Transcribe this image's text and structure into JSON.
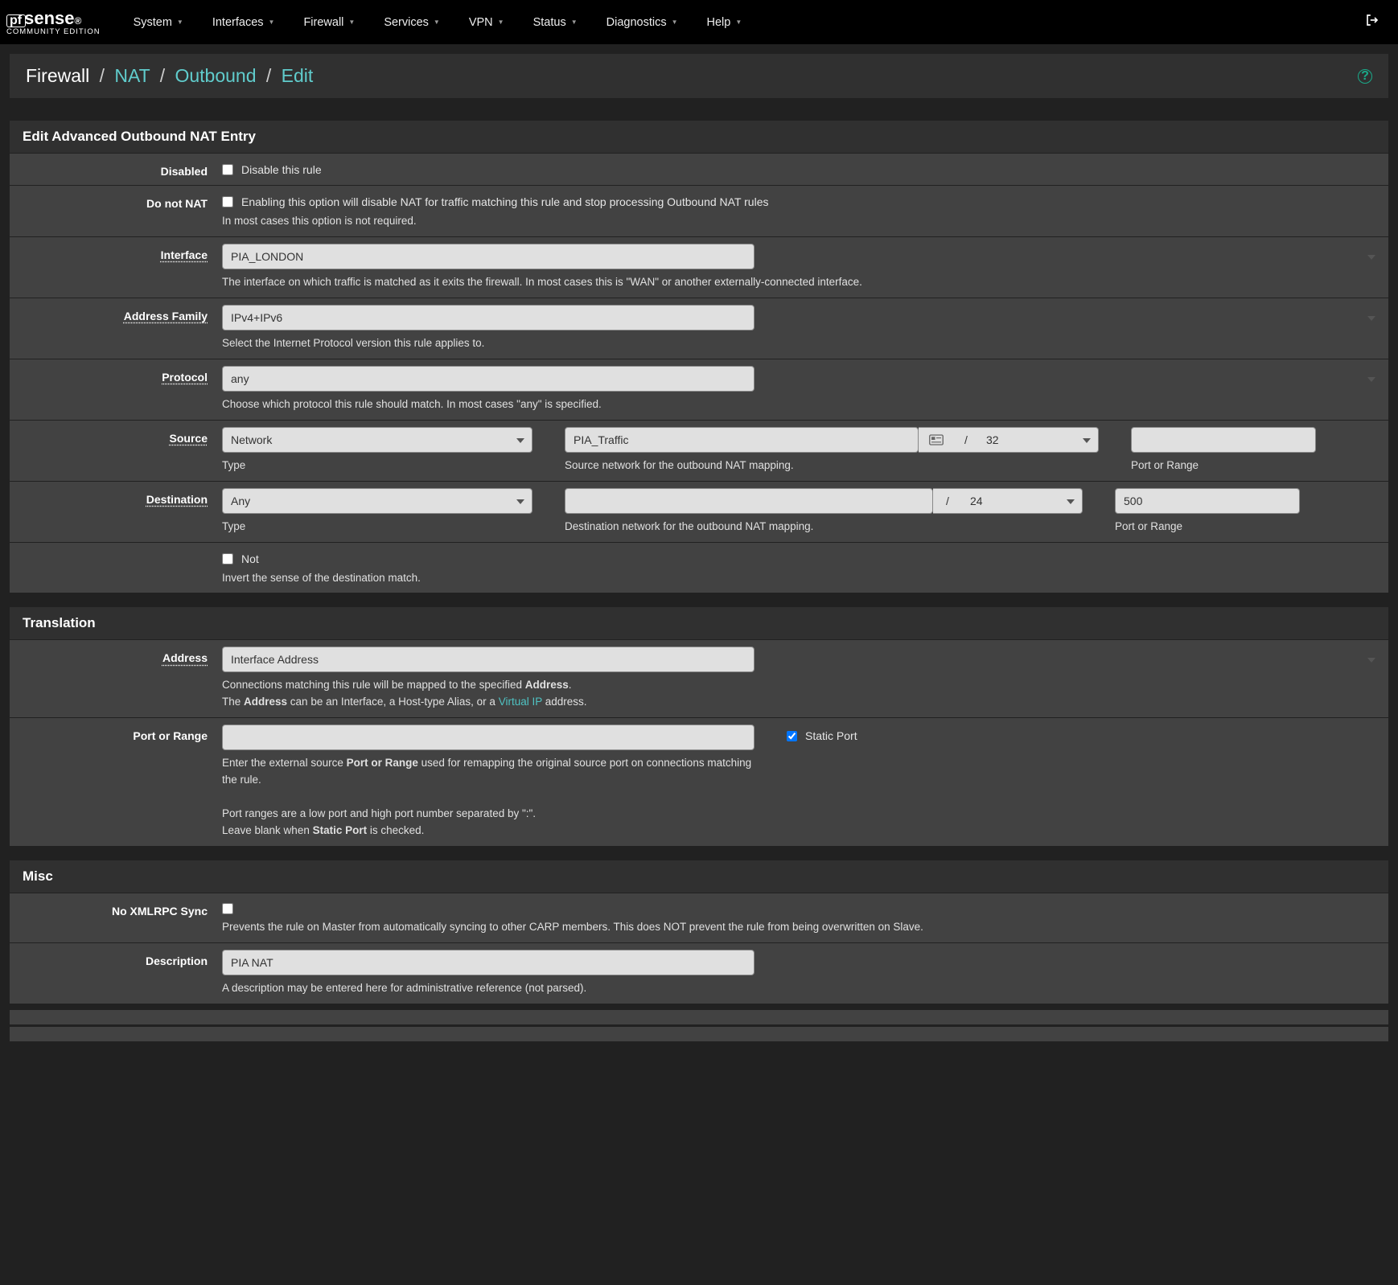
{
  "nav": {
    "items": [
      "System",
      "Interfaces",
      "Firewall",
      "Services",
      "VPN",
      "Status",
      "Diagnostics",
      "Help"
    ]
  },
  "logo": {
    "main_prefix": "pf",
    "main_suffix": "sense",
    "sub": "COMMUNITY EDITION"
  },
  "breadcrumb": {
    "firewall": "Firewall",
    "nat": "NAT",
    "outbound": "Outbound",
    "edit": "Edit"
  },
  "panel1": {
    "title": "Edit Advanced Outbound NAT Entry",
    "disabled": {
      "label": "Disabled",
      "cb_label": "Disable this rule"
    },
    "nonat": {
      "label": "Do not NAT",
      "cb_label": "Enabling this option will disable NAT for traffic matching this rule and stop processing Outbound NAT rules",
      "help": "In most cases this option is not required."
    },
    "iface": {
      "label": "Interface",
      "value": "PIA_LONDON",
      "help": "The interface on which traffic is matched as it exits the firewall. In most cases this is \"WAN\" or another externally-connected interface."
    },
    "af": {
      "label": "Address Family",
      "value": "IPv4+IPv6",
      "help": "Select the Internet Protocol version this rule applies to."
    },
    "proto": {
      "label": "Protocol",
      "value": "any",
      "help": "Choose which protocol this rule should match. In most cases \"any\" is specified."
    },
    "source": {
      "label": "Source",
      "type": "Network",
      "type_help": "Type",
      "net": "PIA_Traffic",
      "net_help": "Source network for the outbound NAT mapping.",
      "cidr": "32",
      "port": "",
      "port_help": "Port or Range"
    },
    "dest": {
      "label": "Destination",
      "type": "Any",
      "type_help": "Type",
      "net": "",
      "net_help": "Destination network for the outbound NAT mapping.",
      "cidr": "24",
      "port": "500",
      "port_help": "Port or Range"
    },
    "not": {
      "cb_label": "Not",
      "help": "Invert the sense of the destination match."
    }
  },
  "panel2": {
    "title": "Translation",
    "addr": {
      "label": "Address",
      "value": "Interface Address",
      "help1_a": "Connections matching this rule will be mapped to the specified ",
      "help1_b": "Address",
      "help1_c": ".",
      "help2_a": "The ",
      "help2_b": "Address",
      "help2_c": " can be an Interface, a Host-type Alias, or a ",
      "help2_link": "Virtual IP",
      "help2_d": " address."
    },
    "port": {
      "label": "Port or Range",
      "value": "",
      "static_label": "Static Port",
      "help_a": "Enter the external source ",
      "help_b": "Port or Range",
      "help_c": " used for remapping the original source port on connections matching the rule.",
      "help2": "Port ranges are a low port and high port number separated by \":\".",
      "help3_a": "Leave blank when ",
      "help3_b": "Static Port",
      "help3_c": " is checked."
    }
  },
  "panel3": {
    "title": "Misc",
    "nosync": {
      "label": "No XMLRPC Sync",
      "help": "Prevents the rule on Master from automatically syncing to other CARP members. This does NOT prevent the rule from being overwritten on Slave."
    },
    "descr": {
      "label": "Description",
      "value": "PIA NAT",
      "help": "A description may be entered here for administrative reference (not parsed)."
    }
  }
}
